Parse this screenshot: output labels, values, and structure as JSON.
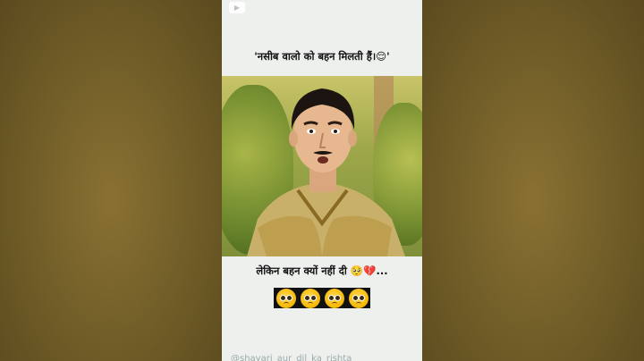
{
  "overlay": {
    "top_caption": "'नसीब वालो को बहन मिलती हैं।😌'",
    "bottom_caption": "लेकिन बहन क्यों नहीं दी 🥺💔...",
    "emoji_row": [
      "pleading-face",
      "pleading-face",
      "pleading-face",
      "pleading-face"
    ],
    "watermark": "@shayari_aur_dil_ka_rishta"
  },
  "colors": {
    "phone_bg": "#eef0ee",
    "side_bg": "#6f5c27",
    "emoji_strip_bg": "#111111",
    "caption_text": "#111111"
  }
}
